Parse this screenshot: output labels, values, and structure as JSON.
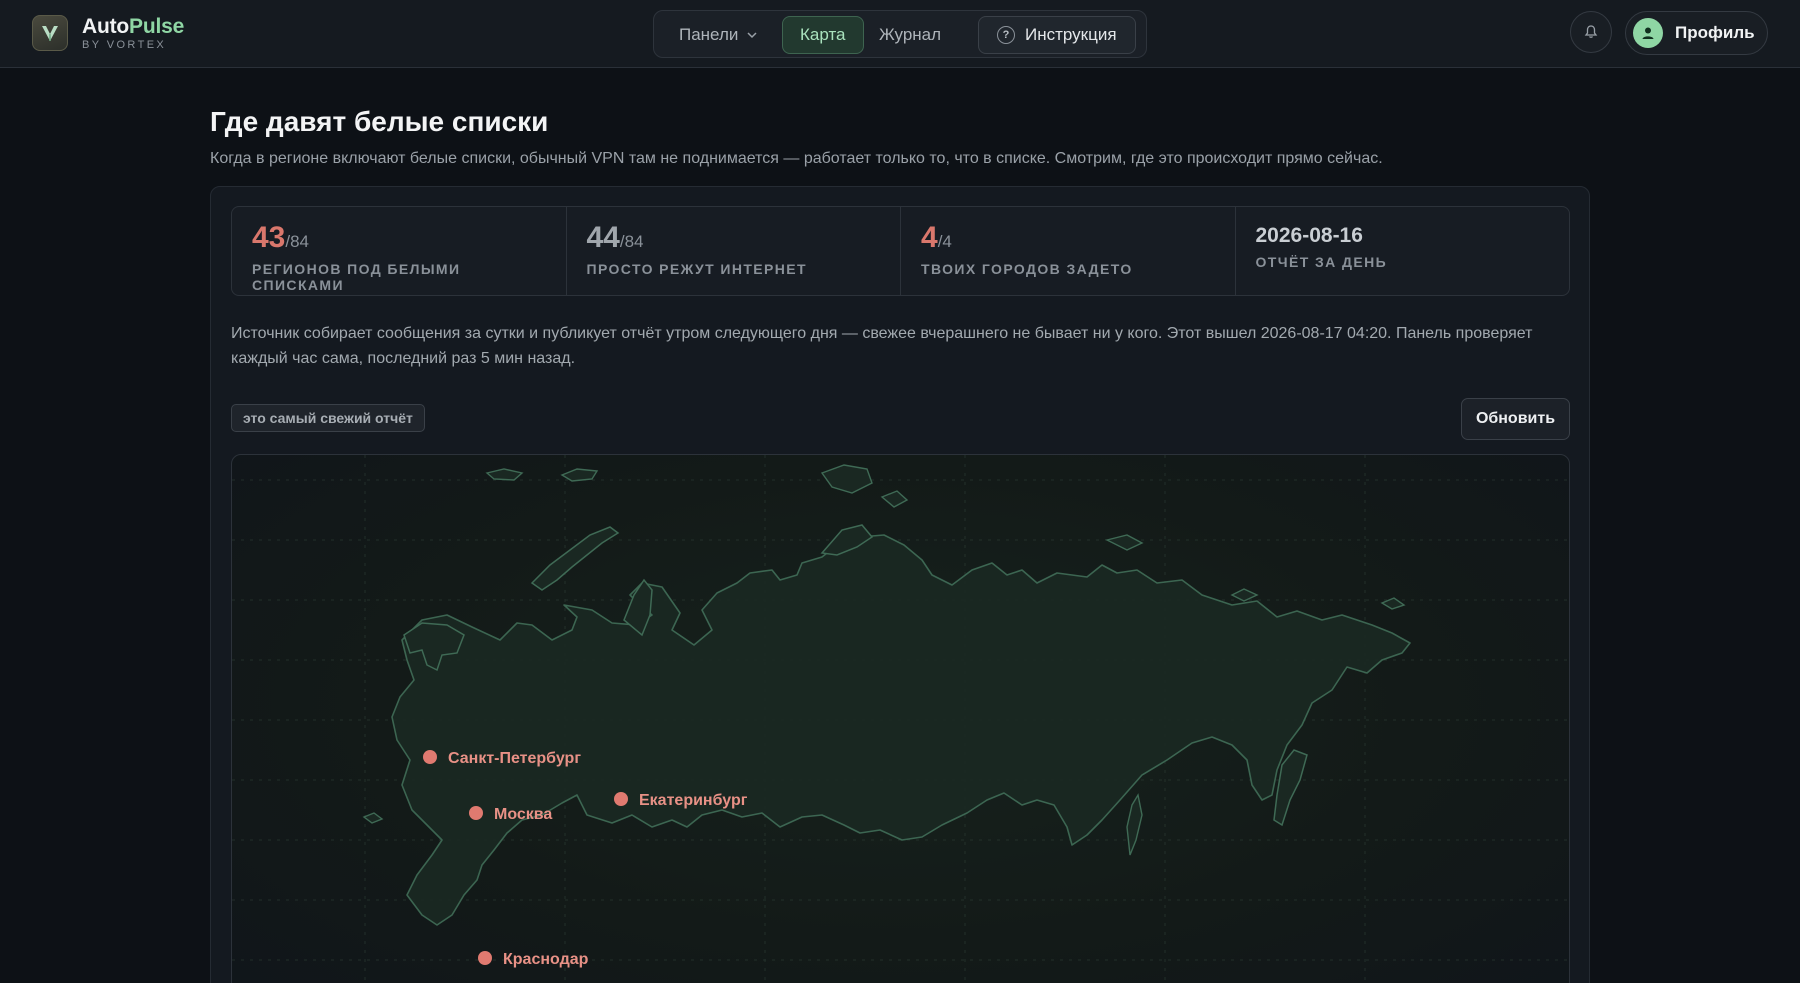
{
  "brand": {
    "name_main": "Auto",
    "name_accent": "Pulse",
    "sub": "BY VORTEX",
    "accent_color": "#8fd6a4"
  },
  "nav": {
    "items": [
      {
        "label": "Панели",
        "icon": "chevron-down-icon",
        "active": false
      },
      {
        "label": "Карта",
        "active": true
      },
      {
        "label": "Журнал",
        "active": false
      },
      {
        "label": "Инструкция",
        "icon": "help-circle-icon",
        "active": false
      }
    ]
  },
  "header": {
    "bell_icon": "bell-icon",
    "profile_label": "Профиль",
    "profile_icon": "user-icon"
  },
  "page": {
    "title": "Где давят белые списки",
    "subtitle": "Когда в регионе включают белые списки, обычный VPN там не поднимается — работает только то, что в списке. Смотрим, где это происходит прямо сейчас."
  },
  "stats": [
    {
      "value": "43",
      "total": "/84",
      "label": "РЕГИОНОВ ПОД БЕЛЫМИ СПИСКАМИ",
      "color": "#d9776c"
    },
    {
      "value": "44",
      "total": "/84",
      "label": "ПРОСТО РЕЖУТ ИНТЕРНЕТ",
      "color": "#a0a6ac"
    },
    {
      "value": "4",
      "total": "/4",
      "label": "ТВОИХ ГОРОДОВ ЗАДЕТО",
      "color": "#d9776c"
    },
    {
      "value": "2026-08-16",
      "label": "ОТЧЁТ ЗА ДЕНЬ"
    }
  ],
  "note": "Источник собирает сообщения за сутки и публикует отчёт утром следующего дня — свежее вчерашнего не бывает ни у кого. Этот вышел 2026-08-17 04:20. Панель проверяет каждый час сама, последний раз 5 мин назад.",
  "badge": "это самый свежий отчёт",
  "refresh_label": "Обновить",
  "map": {
    "marker_color": "#e07a70",
    "cities": [
      {
        "name": "Санкт-Петербург"
      },
      {
        "name": "Москва"
      },
      {
        "name": "Екатеринбург"
      },
      {
        "name": "Краснодар"
      }
    ]
  }
}
